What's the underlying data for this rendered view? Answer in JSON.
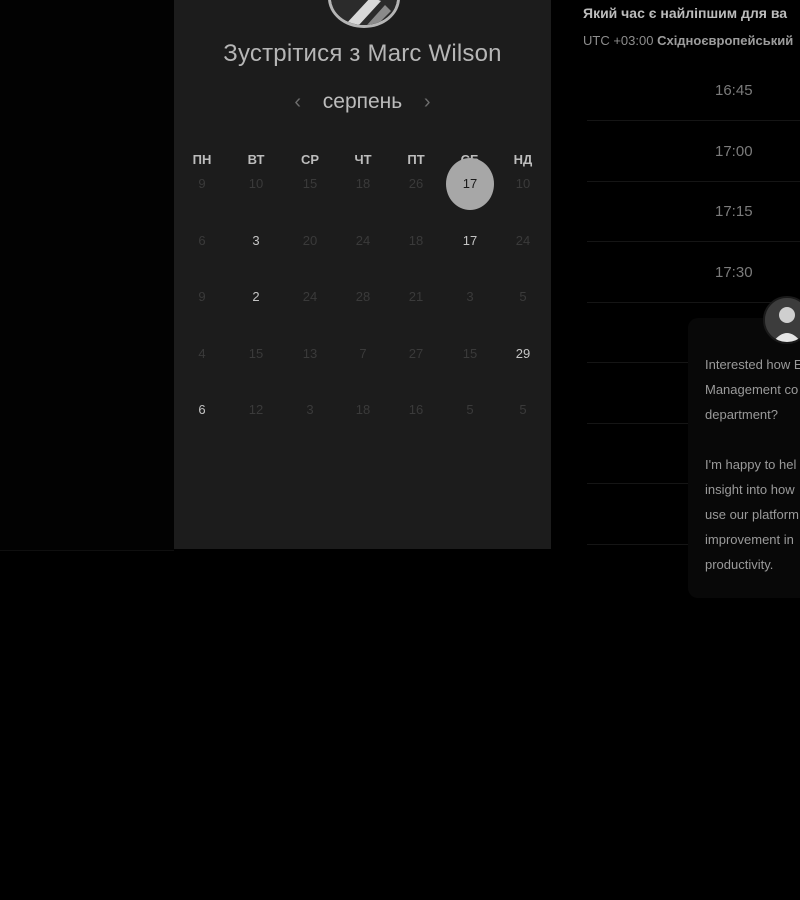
{
  "booking": {
    "title": "Зустрітися з Marc Wilson",
    "month": "серпень",
    "prev_icon": "‹",
    "next_icon": "›"
  },
  "calendar": {
    "weekdays": [
      "ПН",
      "ВТ",
      "СР",
      "ЧТ",
      "ПТ",
      "СБ",
      "НД"
    ],
    "rows": [
      [
        {
          "d": "9",
          "a": false
        },
        {
          "d": "10",
          "a": false
        },
        {
          "d": "15",
          "a": false
        },
        {
          "d": "18",
          "a": false
        },
        {
          "d": "26",
          "a": false
        },
        {
          "d": "17",
          "a": true,
          "sel": true
        },
        {
          "d": "10",
          "a": false
        }
      ],
      [
        {
          "d": "6",
          "a": false
        },
        {
          "d": "3",
          "a": true
        },
        {
          "d": "20",
          "a": false
        },
        {
          "d": "24",
          "a": false
        },
        {
          "d": "18",
          "a": false
        },
        {
          "d": "17",
          "a": true
        },
        {
          "d": "24",
          "a": false
        }
      ],
      [
        {
          "d": "9",
          "a": false
        },
        {
          "d": "2",
          "a": true
        },
        {
          "d": "24",
          "a": false
        },
        {
          "d": "28",
          "a": false
        },
        {
          "d": "21",
          "a": false
        },
        {
          "d": "3",
          "a": false
        },
        {
          "d": "5",
          "a": false
        }
      ],
      [
        {
          "d": "4",
          "a": false
        },
        {
          "d": "15",
          "a": false
        },
        {
          "d": "13",
          "a": false
        },
        {
          "d": "7",
          "a": false
        },
        {
          "d": "27",
          "a": false
        },
        {
          "d": "15",
          "a": false
        },
        {
          "d": "29",
          "a": true
        }
      ],
      [
        {
          "d": "6",
          "a": true
        },
        {
          "d": "12",
          "a": false
        },
        {
          "d": "3",
          "a": false
        },
        {
          "d": "18",
          "a": false
        },
        {
          "d": "16",
          "a": false
        },
        {
          "d": "5",
          "a": false
        },
        {
          "d": "5",
          "a": false
        }
      ]
    ]
  },
  "times": {
    "question": "Який час є найліпшим для ва",
    "tz_prefix": "UTC +03:00",
    "tz_name": "Східноєвропейський",
    "slots": [
      "16:45",
      "17:00",
      "17:15",
      "17:30",
      "",
      "",
      "",
      ""
    ]
  },
  "chat": {
    "message": "Interested how E\nManagement co\ndepartment?\n\nI'm happy to hel\ninsight into how\nuse our platform\nimprovement in\nproductivity."
  },
  "colors": {
    "panel_bg": "#1c1c1c",
    "selected_day_bg": "#a7a7a7"
  }
}
